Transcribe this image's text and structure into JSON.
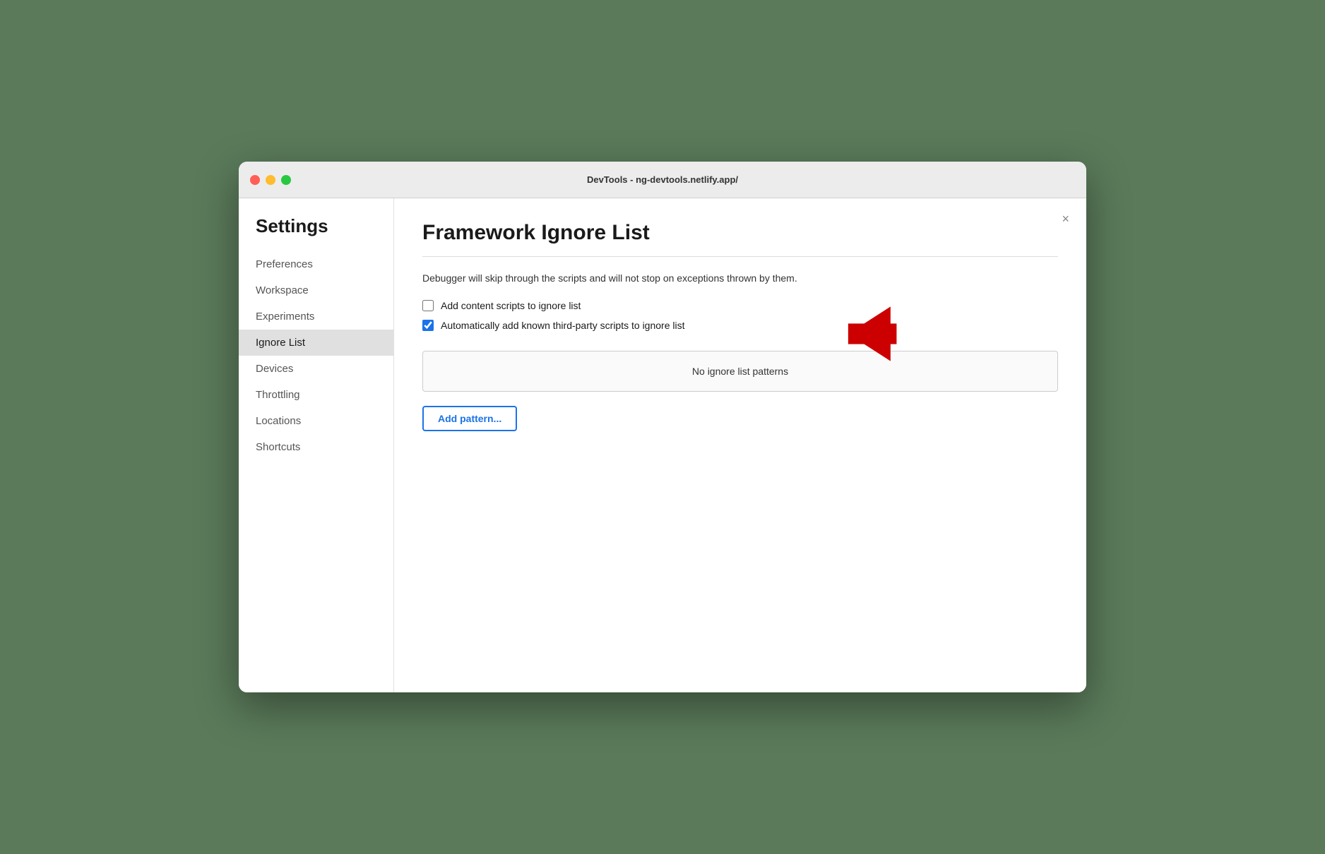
{
  "window": {
    "title": "DevTools - ng-devtools.netlify.app/"
  },
  "sidebar": {
    "heading": "Settings",
    "items": [
      {
        "id": "preferences",
        "label": "Preferences",
        "active": false
      },
      {
        "id": "workspace",
        "label": "Workspace",
        "active": false
      },
      {
        "id": "experiments",
        "label": "Experiments",
        "active": false
      },
      {
        "id": "ignore-list",
        "label": "Ignore List",
        "active": true
      },
      {
        "id": "devices",
        "label": "Devices",
        "active": false
      },
      {
        "id": "throttling",
        "label": "Throttling",
        "active": false
      },
      {
        "id": "locations",
        "label": "Locations",
        "active": false
      },
      {
        "id": "shortcuts",
        "label": "Shortcuts",
        "active": false
      }
    ]
  },
  "main": {
    "title": "Framework Ignore List",
    "description": "Debugger will skip through the scripts and will not stop on exceptions thrown by them.",
    "checkboxes": [
      {
        "id": "add-content-scripts",
        "label": "Add content scripts to ignore list",
        "checked": false
      },
      {
        "id": "auto-add-third-party",
        "label": "Automatically add known third-party scripts to ignore list",
        "checked": true
      }
    ],
    "patterns_empty_text": "No ignore list patterns",
    "add_pattern_label": "Add pattern...",
    "close_label": "×"
  }
}
